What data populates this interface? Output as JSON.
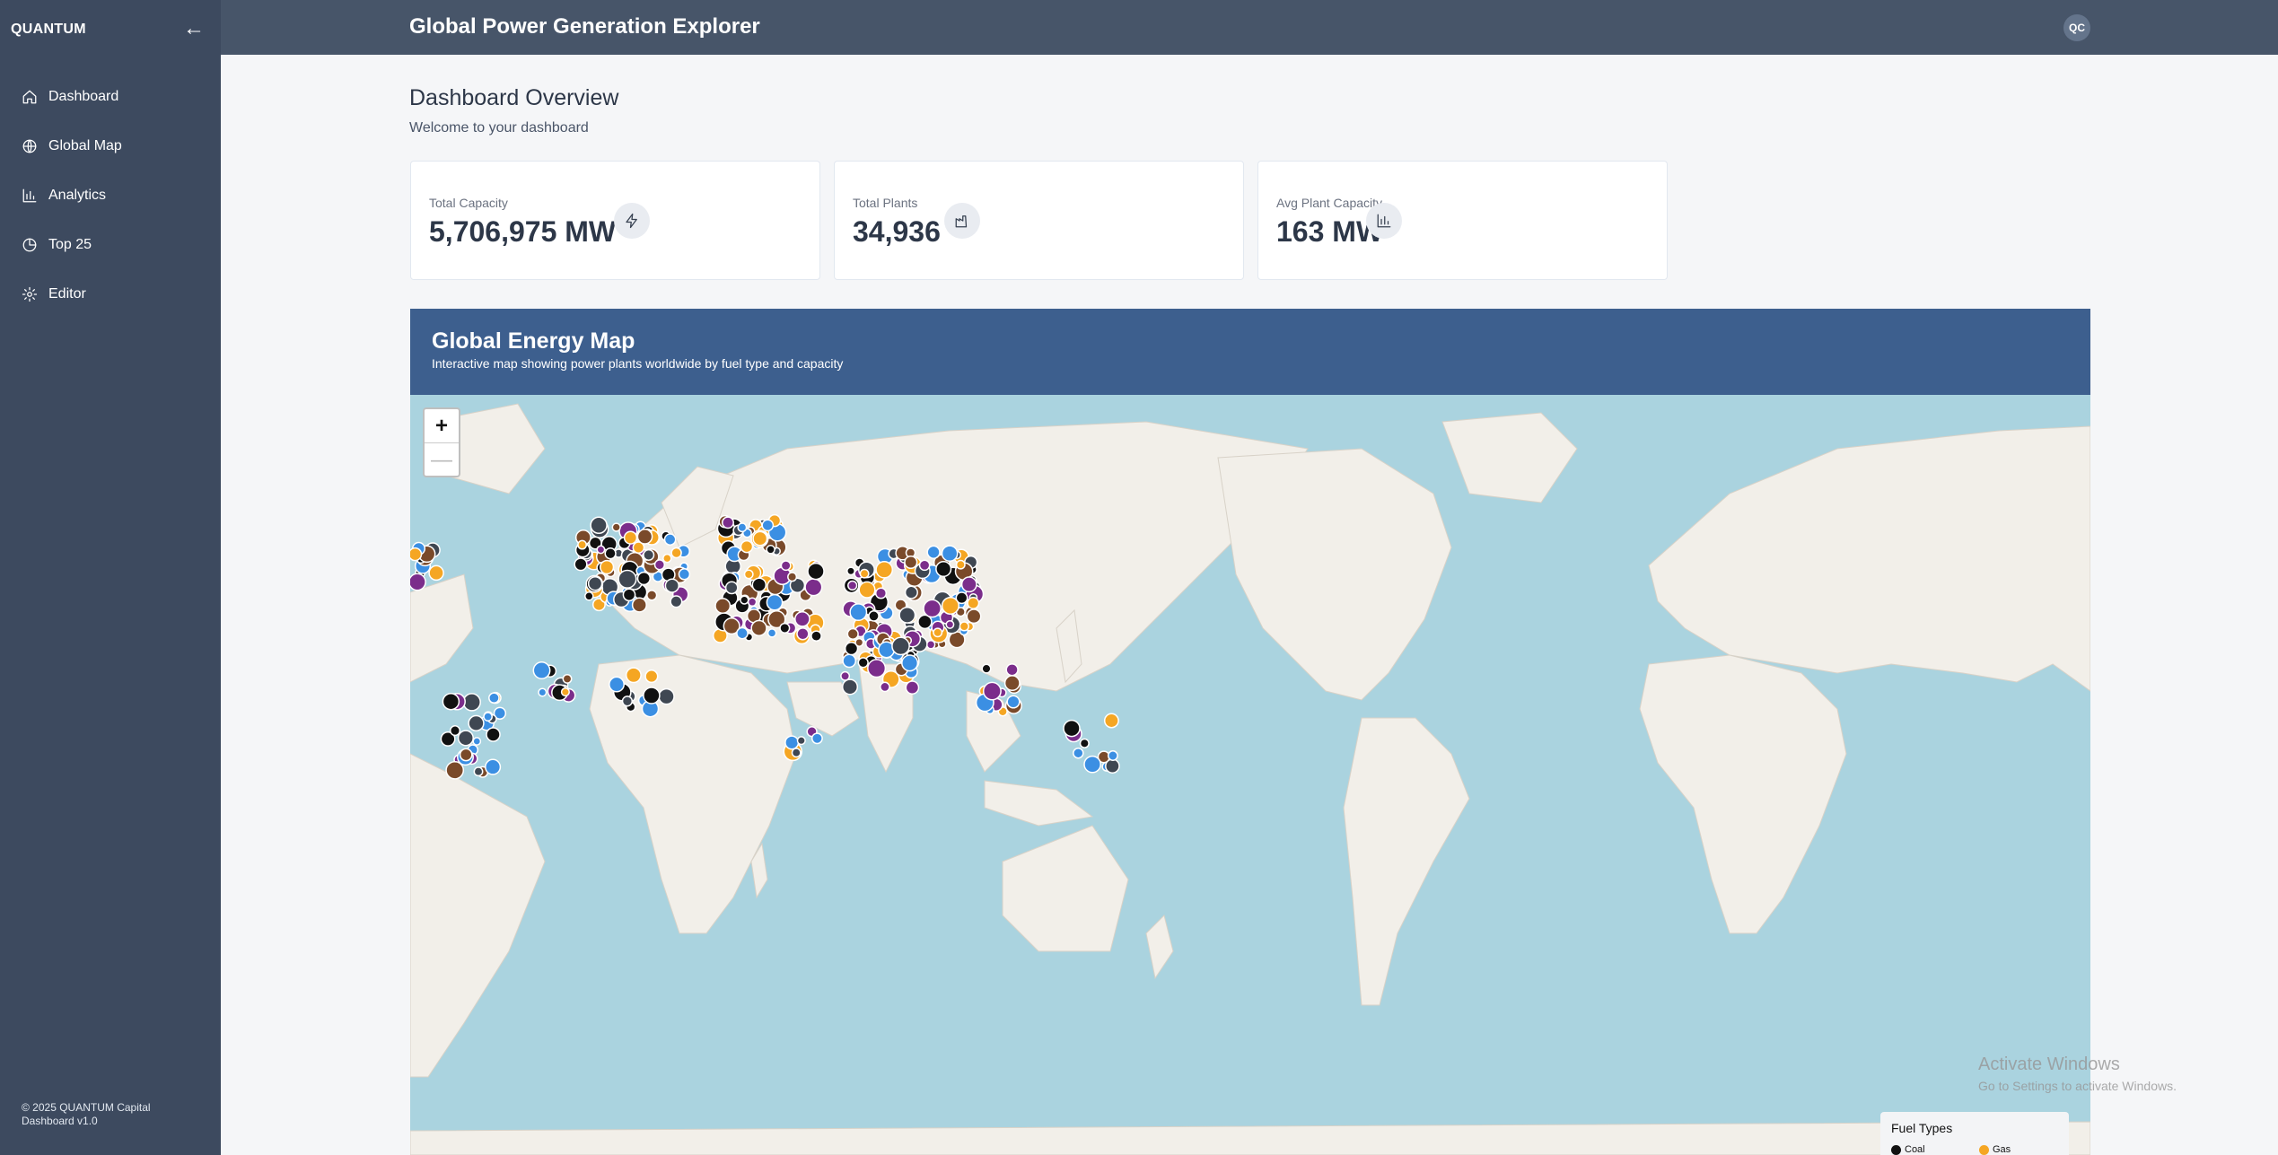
{
  "sidebar": {
    "brand": "QUANTUM",
    "collapse_icon": "arrow-left-icon",
    "items": [
      {
        "label": "Dashboard",
        "icon": "home-icon"
      },
      {
        "label": "Global Map",
        "icon": "globe-icon"
      },
      {
        "label": "Analytics",
        "icon": "bar-chart-icon"
      },
      {
        "label": "Top 25",
        "icon": "pie-chart-icon"
      },
      {
        "label": "Editor",
        "icon": "gear-icon"
      }
    ],
    "footer_line1": "© 2025 QUANTUM Capital",
    "footer_line2": "Dashboard v1.0"
  },
  "header": {
    "title": "Global Power Generation Explorer",
    "avatar_initials": "QC"
  },
  "overview": {
    "title": "Dashboard Overview",
    "subtitle": "Welcome to your dashboard"
  },
  "cards": [
    {
      "label": "Total Capacity",
      "value": "5,706,975 MW",
      "icon": "lightning-icon"
    },
    {
      "label": "Total Plants",
      "value": "34,936",
      "icon": "factory-icon"
    },
    {
      "label": "Avg Plant Capacity",
      "value": "163 MW",
      "icon": "bar-chart-icon"
    }
  ],
  "map": {
    "title": "Global Energy Map",
    "subtitle": "Interactive map showing power plants worldwide by fuel type and capacity",
    "zoom_in": "+",
    "zoom_out": "—",
    "legend": {
      "title": "Fuel Types",
      "items": [
        {
          "label": "Coal",
          "color": "#111111"
        },
        {
          "label": "Gas",
          "color": "#f5a623"
        }
      ]
    }
  },
  "colors": {
    "sidebar": "#3d4a5f",
    "header": "#475569",
    "map_header": "#3d5f8e",
    "ocean": "#aad3df",
    "land": "#f2efe9",
    "coal": "#111111",
    "gas": "#f5a623",
    "hydro": "#3b8fe3",
    "nuclear": "#7b2d8b",
    "oil": "#7a4a2a",
    "other": "#3f4752"
  },
  "watermark": {
    "line1": "Activate Windows",
    "line2": "Go to Settings to activate Windows."
  }
}
